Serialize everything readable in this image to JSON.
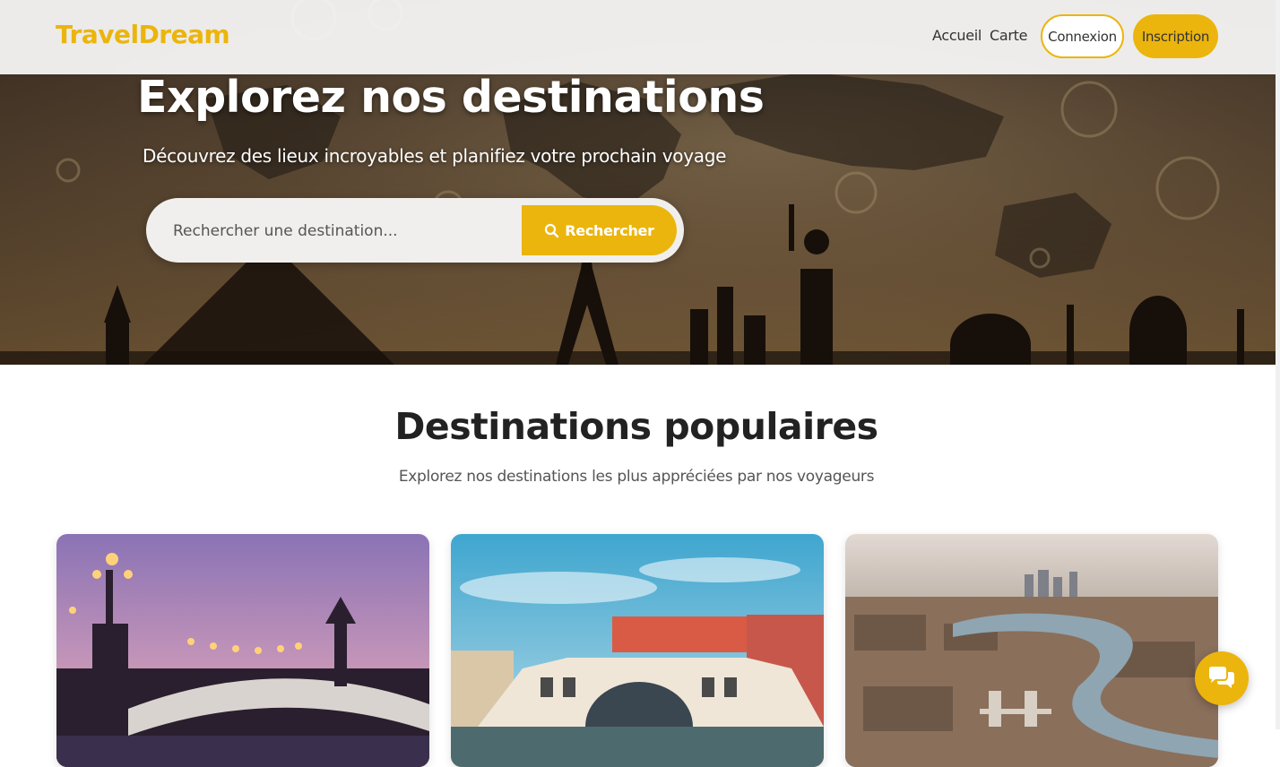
{
  "brand": {
    "name": "TravelDream",
    "accent_color": "#ebb50d"
  },
  "nav": {
    "links": [
      "Accueil",
      "Carte"
    ],
    "login_label": "Connexion",
    "signup_label": "Inscription"
  },
  "hero": {
    "title": "Explorez nos destinations",
    "subtitle": "Découvrez des lieux incroyables et planifiez votre prochain voyage",
    "search": {
      "placeholder": "Rechercher une destination...",
      "button_label": "Rechercher",
      "button_icon": "search-icon"
    }
  },
  "popular": {
    "title": "Destinations populaires",
    "subtitle": "Explorez nos destinations les plus appréciées par nos voyageurs",
    "cards": [
      {
        "image": "paris-bridge-at-dusk"
      },
      {
        "image": "venice-rialto-bridge"
      },
      {
        "image": "london-river-aerial"
      }
    ]
  },
  "chat": {
    "icon": "chat-bubbles-icon"
  }
}
